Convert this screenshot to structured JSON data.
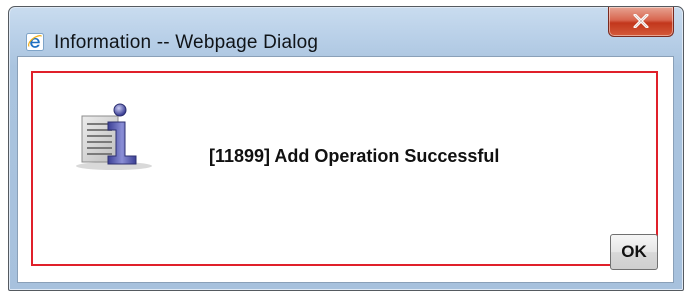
{
  "window": {
    "title": "Information -- Webpage Dialog",
    "close_label": "X"
  },
  "dialog": {
    "message": "[11899] Add Operation Successful",
    "ok_label": "OK",
    "icon": "information-icon"
  },
  "colors": {
    "frame_border": "#e0202a",
    "title_bar": "#b9d0e8",
    "close_button": "#c2371c"
  }
}
